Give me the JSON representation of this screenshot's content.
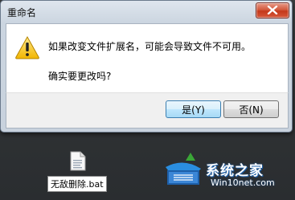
{
  "dialog": {
    "title": "重命名",
    "message": "如果改变文件扩展名，可能会导致文件不可用。",
    "question": "确实要更改吗?",
    "buttons": {
      "yes_label": "是(Y)",
      "no_label": "否(N)"
    },
    "icon": "warning-icon"
  },
  "desktop": {
    "file_name": "无敌删除.bat",
    "file_icon": "batch-file-icon"
  },
  "watermark": {
    "title": "系统之家",
    "url": "Win10net.com"
  },
  "colors": {
    "close_button": "#c5391b",
    "default_button_border": "#3c7fb1",
    "watermark_blue": "#1d5fa8"
  }
}
